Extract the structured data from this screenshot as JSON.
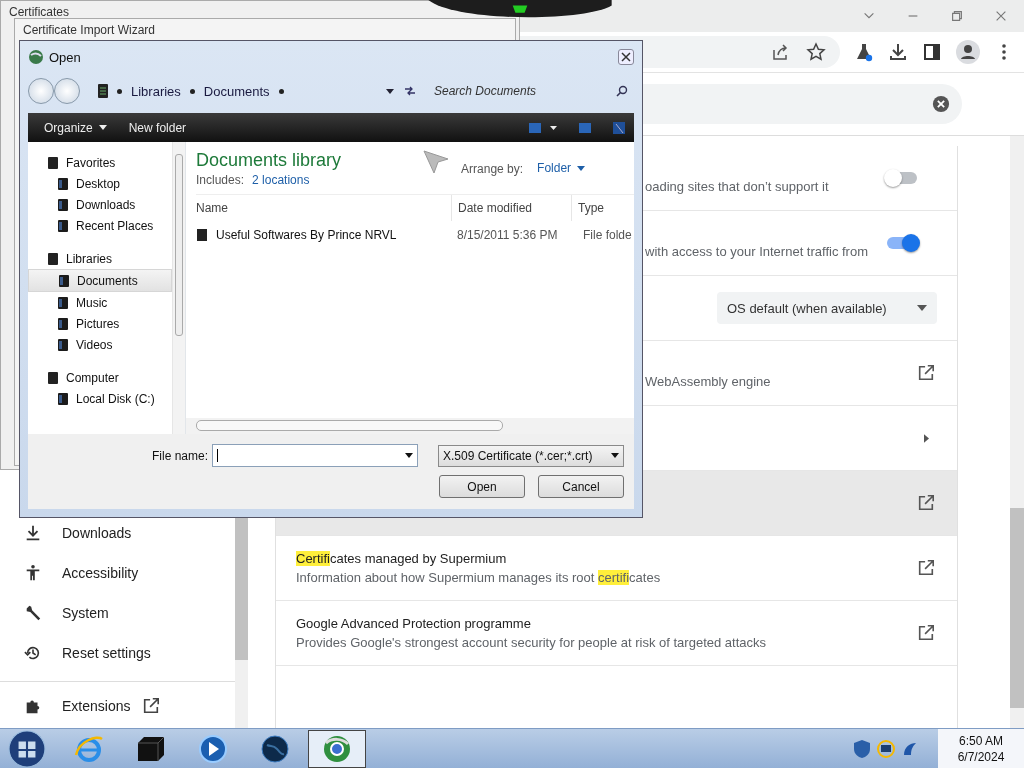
{
  "certificates_window": {
    "title": "Certificates"
  },
  "wizard_window": {
    "title": "Certificate Import Wizard"
  },
  "browser": {
    "sidebar": [
      {
        "label": "Downloads",
        "kind": "download",
        "external": false
      },
      {
        "label": "Accessibility",
        "kind": "accessibility",
        "external": false
      },
      {
        "label": "System",
        "kind": "wrench",
        "external": false
      },
      {
        "label": "Reset settings",
        "kind": "history",
        "external": false
      },
      {
        "label": "Extensions",
        "kind": "puzzle",
        "external": true
      }
    ],
    "settings_rows": [
      {
        "kind": "toggle",
        "on": false,
        "covered": true,
        "hovered": false,
        "description": [
          {
            "text": "oading sites that don’t support it",
            "match": false
          }
        ]
      },
      {
        "kind": "toggle",
        "on": true,
        "covered": true,
        "hovered": false,
        "description": [
          {
            "text": "with access to your Internet traffic from",
            "match": false
          }
        ]
      },
      {
        "kind": "select",
        "hovered": false,
        "value": "OS default (when available)"
      },
      {
        "kind": "external",
        "covered": true,
        "hovered": false,
        "description": [
          {
            "text": "WebAssembly engine",
            "match": false
          }
        ]
      },
      {
        "kind": "submenu",
        "covered": true,
        "hovered": false
      },
      {
        "kind": "external",
        "covered": true,
        "hovered": true
      },
      {
        "kind": "external",
        "covered": false,
        "hovered": false,
        "title": [
          {
            "text": "Certifi",
            "match": true
          },
          {
            "text": "cates managed by Supermium",
            "match": false
          }
        ],
        "description": [
          {
            "text": "Information about how Supermium manages its root ",
            "match": false
          },
          {
            "text": "certifi",
            "match": true
          },
          {
            "text": "cates",
            "match": false
          }
        ]
      },
      {
        "kind": "external",
        "covered": false,
        "hovered": false,
        "title": [
          {
            "text": "Google Advanced Protection programme",
            "match": false
          }
        ],
        "description": [
          {
            "text": "Provides Google's strongest account security for people at risk of targeted attacks",
            "match": false
          }
        ]
      }
    ]
  },
  "open_dialog": {
    "title": "Open",
    "breadcrumb": [
      "Libraries",
      "Documents"
    ],
    "search": {
      "placeholder": "Search Documents"
    },
    "toolbar": [
      {
        "label": "Organize",
        "menu": true
      },
      {
        "label": "New folder",
        "menu": false
      }
    ],
    "nav": [
      {
        "label": "Favorites",
        "selected": false,
        "children": [
          {
            "label": "Desktop",
            "selected": false
          },
          {
            "label": "Downloads",
            "selected": false
          },
          {
            "label": "Recent Places",
            "selected": false
          }
        ]
      },
      {
        "label": "Libraries",
        "selected": false,
        "children": [
          {
            "label": "Documents",
            "selected": true
          },
          {
            "label": "Music",
            "selected": false
          },
          {
            "label": "Pictures",
            "selected": false
          },
          {
            "label": "Videos",
            "selected": false
          }
        ]
      },
      {
        "label": "Computer",
        "selected": false,
        "children": [
          {
            "label": "Local Disk (C:)",
            "selected": false
          }
        ]
      }
    ],
    "library": {
      "title": "Documents library",
      "includes_label": "Includes:",
      "includes_link": "2 locations",
      "arrange_label": "Arrange by:",
      "arrange_value": "Folder"
    },
    "columns": [
      "Name",
      "Date modified",
      "Type"
    ],
    "rows": [
      {
        "name": "Useful Softwares By Prince NRVL",
        "date": "8/15/2011 5:36 PM",
        "type": "File folde"
      }
    ],
    "file_name": {
      "label": "File name:"
    },
    "file_type": "X.509 Certificate (*.cer;*.crt)",
    "buttons": [
      "Open",
      "Cancel"
    ]
  },
  "taskbar": {
    "apps": [
      {
        "kind": "ie",
        "active": false
      },
      {
        "kind": "box",
        "active": false
      },
      {
        "kind": "media",
        "active": false
      },
      {
        "kind": "globe",
        "active": false
      },
      {
        "kind": "browser",
        "active": true
      }
    ],
    "time": "6:50 AM",
    "date": "6/7/2024"
  }
}
